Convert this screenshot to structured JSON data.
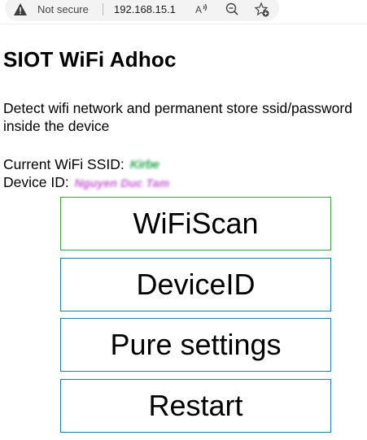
{
  "browser": {
    "security_label": "Not secure",
    "url": "192.168.15.1",
    "icons": [
      "warning-triangle-icon",
      "read-aloud-icon",
      "zoom-out-icon",
      "add-favorite-icon"
    ]
  },
  "page": {
    "title": "SIOT WiFi Adhoc",
    "description": "Detect wifi network and permanent store ssid/password inside the device",
    "ssid_label": "Current WiFi SSID:",
    "ssid_value": "Kirbe",
    "device_label": "Device ID:",
    "device_value": "Nguyen Duc Tam"
  },
  "buttons": {
    "wifiscan": "WiFiScan",
    "deviceid": "DeviceID",
    "pure_settings": "Pure settings",
    "restart": "Restart"
  },
  "colors": {
    "button_border": "#1e7fa3",
    "wifiscan_border": "#3fa34d",
    "ssid_blur": "#2faa54",
    "device_blur": "#c35ad1"
  }
}
